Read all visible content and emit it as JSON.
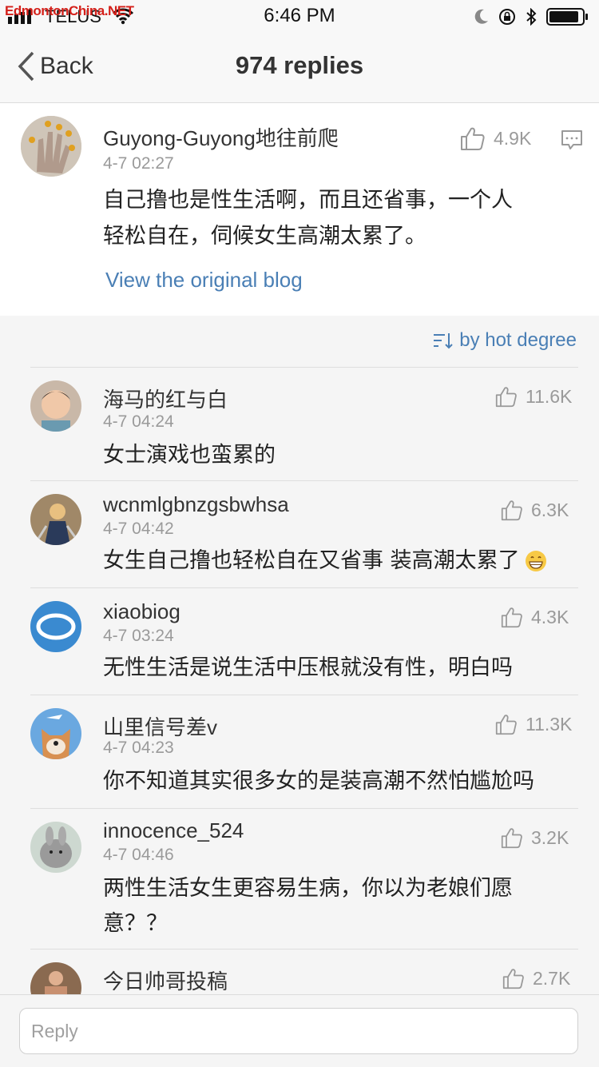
{
  "status_bar": {
    "watermark": "EdmontonChina.NET",
    "carrier": "TELUS",
    "time": "6:46 PM"
  },
  "nav": {
    "back_label": "Back",
    "title": "974 replies"
  },
  "main_post": {
    "username": "Guyong-Guyong地往前爬",
    "timestamp": "4-7 02:27",
    "likes": "4.9K",
    "text_line1": "自己撸也是性生活啊，而且还省事，一个人",
    "text_line2": "轻松自在，伺候女生高潮太累了。",
    "view_original": "View the original blog"
  },
  "sort": {
    "label": "by hot degree"
  },
  "comments": [
    {
      "username": "海马的红与白",
      "timestamp": "4-7 04:24",
      "likes": "11.6K",
      "text": "女士演戏也蛮累的",
      "text2": ""
    },
    {
      "username": "wcnmlgbnzgsbwhsa",
      "timestamp": "4-7 04:42",
      "likes": "6.3K",
      "text": "女生自己撸也轻松自在又省事 装高潮太累了",
      "text2": ""
    },
    {
      "username": "xiaobiog",
      "timestamp": "4-7 03:24",
      "likes": "4.3K",
      "text": "无性生活是说生活中压根就没有性，明白吗",
      "text2": ""
    },
    {
      "username": "山里信号差v",
      "timestamp": "4-7 04:23",
      "likes": "11.3K",
      "text": "你不知道其实很多女的是装高潮不然怕尴尬吗",
      "text2": ""
    },
    {
      "username": "innocence_524",
      "timestamp": "4-7 04:46",
      "likes": "3.2K",
      "text": "两性生活女生更容易生病，你以为老娘们愿",
      "text2": "意？？"
    },
    {
      "username": "今日帅哥投稿",
      "timestamp": "",
      "likes": "2.7K",
      "text": "",
      "text2": ""
    }
  ],
  "footer": {
    "reply_placeholder": "Reply"
  },
  "colors": {
    "link": "#4a7fb5",
    "meta": "#9a9a9a",
    "background": "#f5f5f5"
  },
  "icons": [
    "wifi-icon",
    "moon-icon",
    "rotation-lock-icon",
    "bluetooth-icon",
    "battery-icon",
    "chevron-left-icon",
    "thumbs-up-icon",
    "comment-icon",
    "sort-icon",
    "grin-emoji-icon"
  ]
}
